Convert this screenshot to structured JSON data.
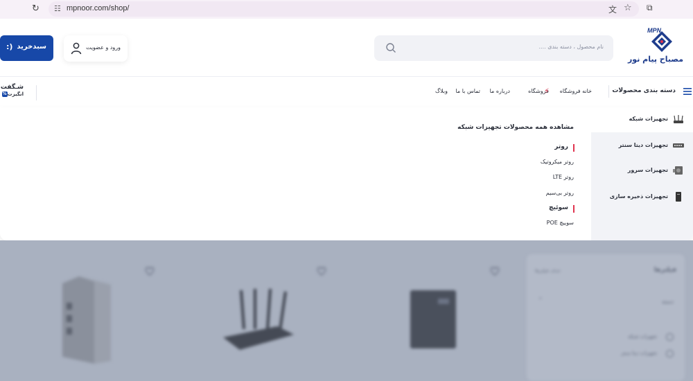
{
  "browser": {
    "url": "mpnoor.com/shop/"
  },
  "header": {
    "logo_text_en": "MPN",
    "logo_text_fa": "مصباح پیام نور",
    "search_placeholder": "نام محصول ، دسته بندی ....",
    "login_label": "ورود و عضویت",
    "cart_label": "سبدخرید",
    "cart_emoji": ":)"
  },
  "nav": {
    "categories_label": "دسته بندی محصولات",
    "links": [
      "خانه فروشگاه",
      "فروشگاه",
      "درباره ما",
      "تماس با ما",
      "وبلاگ"
    ],
    "amazing_title": "شـگفت",
    "amazing_sub": "انگیزت"
  },
  "mega_menu": {
    "side_items": [
      "تجهیزات شبکه",
      "تجهیزات دیتا سنتر",
      "تجهیزات سرور",
      "تجهیزات ذخیره سازی"
    ],
    "view_all": "مشاهده همه محصولات تجهیزات شبکه",
    "groups": [
      {
        "heading": "روتر",
        "items": [
          "روتر میکروتیک",
          "روتر LTE",
          "روتر بی‌سیم"
        ]
      },
      {
        "heading": "سوئیچ",
        "items": [
          "سوییچ POE"
        ]
      }
    ]
  },
  "background": {
    "filter_title": "فیلترها",
    "filter_clear": "حذف فیلترها",
    "filter_section": "دسته",
    "filter_options": [
      "تجهیزات شبکه",
      "تجهیزات دیتا سنتر"
    ]
  },
  "colors": {
    "brand": "#1748a8",
    "accent": "#e0344f"
  }
}
